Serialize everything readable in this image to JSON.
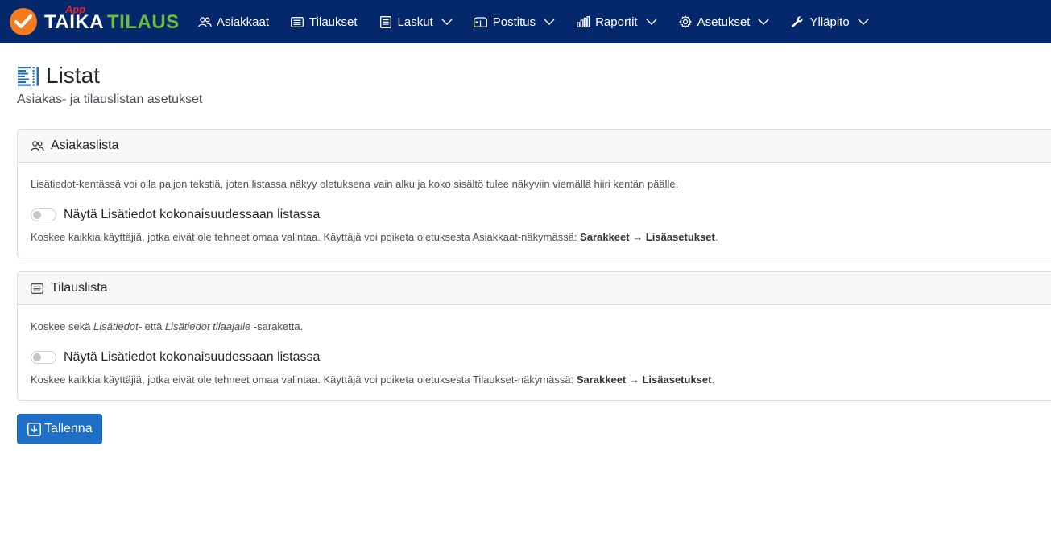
{
  "brand": {
    "app_tag": "App",
    "name_part1": "TAIKA",
    "name_part2": "TILAUS"
  },
  "nav": {
    "items": [
      {
        "label": "Asiakkaat",
        "icon": "users-icon",
        "has_dropdown": false
      },
      {
        "label": "Tilaukset",
        "icon": "list-icon",
        "has_dropdown": false
      },
      {
        "label": "Laskut",
        "icon": "document-icon",
        "has_dropdown": true
      },
      {
        "label": "Postitus",
        "icon": "mailbox-icon",
        "has_dropdown": true
      },
      {
        "label": "Raportit",
        "icon": "bar-chart-icon",
        "has_dropdown": true
      },
      {
        "label": "Asetukset",
        "icon": "gear-icon",
        "has_dropdown": true
      },
      {
        "label": "Ylläpito",
        "icon": "wrench-icon",
        "has_dropdown": true
      }
    ]
  },
  "page": {
    "title": "Listat",
    "subtitle": "Asiakas- ja tilauslistan asetukset",
    "title_icon": "list-columns-icon"
  },
  "cards": {
    "customers": {
      "header": "Asiakaslista",
      "description": "Lisätiedot-kentässä voi olla paljon tekstiä, joten listassa näkyy oletuksena vain alku ja koko sisältö tulee näkyviin viemällä hiiri kentän päälle.",
      "switch_label": "Näytä Lisätiedot kokonaisuudessaan listassa",
      "switch_on": false,
      "note_prefix": "Koskee kaikkia käyttäjiä, jotka eivät ole tehneet omaa valintaa. Käyttäjä voi poiketa oletuksesta Asiakkaat-näkymässä: ",
      "note_bold": "Sarakkeet → Lisäasetukset",
      "note_suffix": "."
    },
    "orders": {
      "header": "Tilauslista",
      "desc_part1": "Koskee sekä ",
      "desc_italic1": "Lisätiedot-",
      "desc_part2": " että ",
      "desc_italic2": "Lisätiedot tilaajalle",
      "desc_part3": " -saraketta.",
      "switch_label": "Näytä Lisätiedot kokonaisuudessaan listassa",
      "switch_on": false,
      "note_prefix": "Koskee kaikkia käyttäjiä, jotka eivät ole tehneet omaa valintaa. Käyttäjä voi poiketa oletuksesta Tilaukset-näkymässä: ",
      "note_bold": "Sarakkeet → Lisäasetukset",
      "note_suffix": "."
    }
  },
  "actions": {
    "save_label": "Tallenna"
  },
  "colors": {
    "navbar": "#04286b",
    "brand_orange": "#f47b20",
    "brand_green": "#6cbf3a",
    "app_red": "#e8262b",
    "primary_button": "#1f6fc7",
    "title_icon_blue": "#1f6fc7"
  }
}
